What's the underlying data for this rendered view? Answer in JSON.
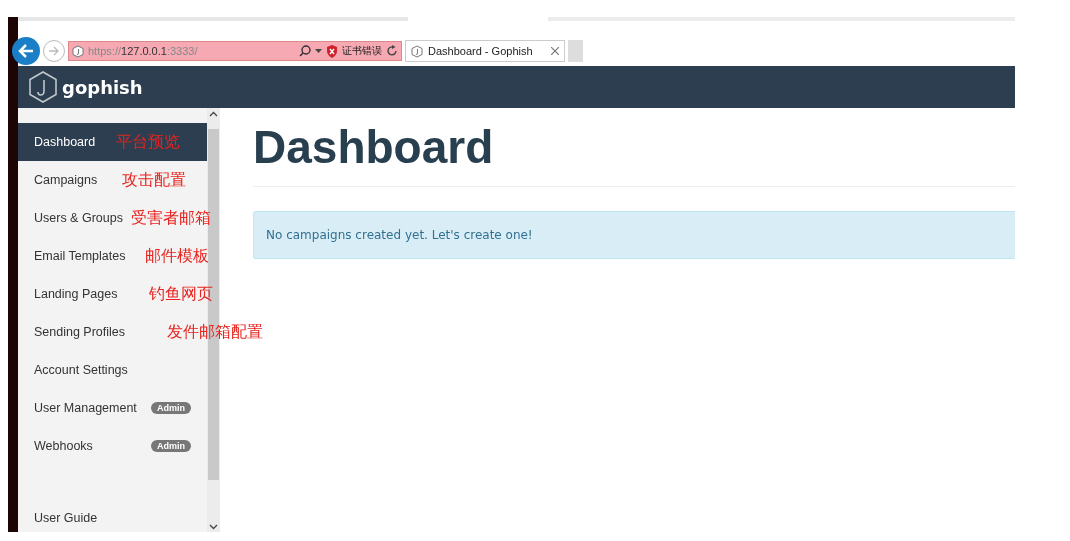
{
  "browser": {
    "url_scheme": "https://",
    "url_host": "127.0.0.1",
    "url_port": ":3333/",
    "cert_error": "证书错误",
    "tab_title": "Dashboard - Gophish"
  },
  "navbar": {
    "brand": "gophish"
  },
  "sidebar": {
    "items": [
      {
        "label": "Dashboard",
        "selected": true,
        "note": "平台预览"
      },
      {
        "label": "Campaigns",
        "selected": false,
        "note": "攻击配置"
      },
      {
        "label": "Users & Groups",
        "selected": false,
        "note": "受害者邮箱"
      },
      {
        "label": "Email Templates",
        "selected": false,
        "note": "邮件模板"
      },
      {
        "label": "Landing Pages",
        "selected": false,
        "note": "钓鱼网页"
      },
      {
        "label": "Sending Profiles",
        "selected": false,
        "note": "发件邮箱配置"
      },
      {
        "label": "Account Settings",
        "selected": false
      },
      {
        "label": "User Management",
        "selected": false,
        "badge": "Admin"
      },
      {
        "label": "Webhooks",
        "selected": false,
        "badge": "Admin"
      }
    ],
    "footer_items": [
      {
        "label": "User Guide",
        "selected": false
      }
    ]
  },
  "main": {
    "title": "Dashboard",
    "alert": "No campaigns created yet. Let's create one!"
  }
}
